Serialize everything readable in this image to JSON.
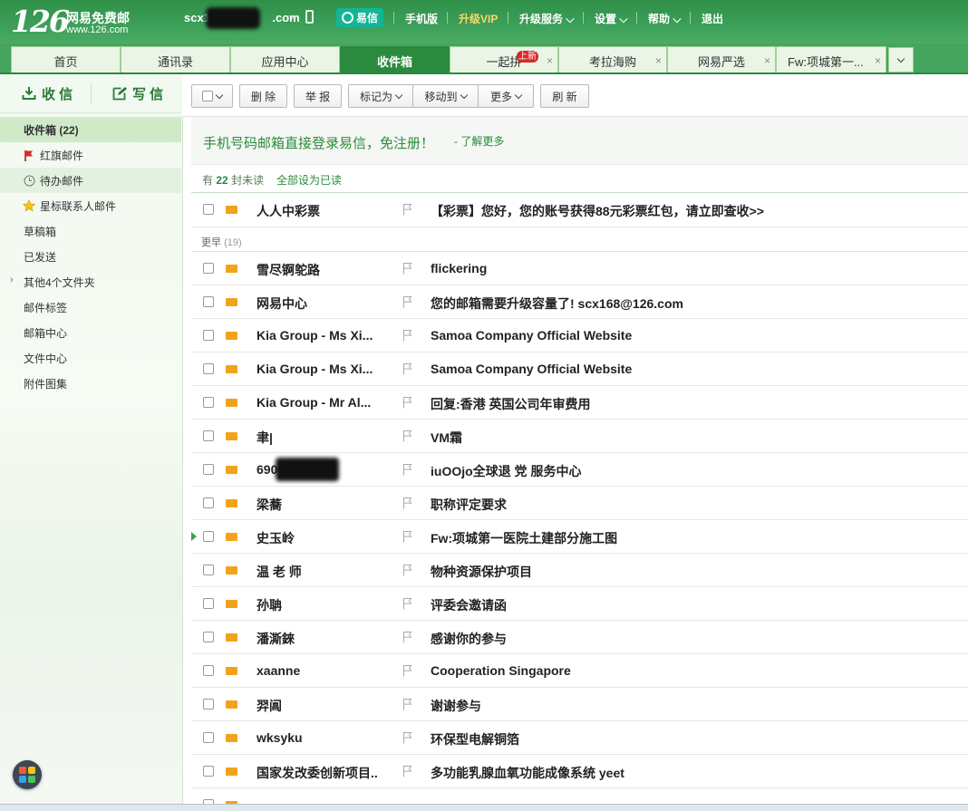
{
  "header": {
    "logo_number": "126",
    "logo_title": "网易免费邮",
    "logo_site": "www.126.com",
    "account_visible": "scx168",
    "account_tail": ".com",
    "yixin": "易信",
    "links": [
      "手机版",
      "升级VIP",
      "升级服务",
      "设置",
      "帮助",
      "退出"
    ]
  },
  "tabs": [
    {
      "label": "首页"
    },
    {
      "label": "通讯录"
    },
    {
      "label": "应用中心"
    },
    {
      "label": "收件箱"
    },
    {
      "label": "一起拼",
      "badge": "上新"
    },
    {
      "label": "考拉海购"
    },
    {
      "label": "网易严选"
    },
    {
      "label": "Fw:项城第一..."
    }
  ],
  "sidebar": {
    "receive": "收 信",
    "compose": "写 信",
    "folders": [
      {
        "label": "收件箱 (22)"
      },
      {
        "label": "红旗邮件"
      },
      {
        "label": "待办邮件"
      },
      {
        "label": "星标联系人邮件"
      },
      {
        "label": "草稿箱"
      },
      {
        "label": "已发送"
      },
      {
        "label": "其他4个文件夹"
      },
      {
        "label": "邮件标签"
      },
      {
        "label": "邮箱中心"
      },
      {
        "label": "文件中心"
      },
      {
        "label": "附件图集"
      }
    ]
  },
  "toolbar": {
    "delete": "删 除",
    "report": "举 报",
    "mark_as": "标记为",
    "move_to": "移动到",
    "more": "更多",
    "refresh": "刷 新"
  },
  "notice": {
    "text": "手机号码邮箱直接登录易信，免注册！",
    "link": "- 了解更多"
  },
  "unread": {
    "prefix": "有",
    "count": "22",
    "suffix": "封未读",
    "mark_all": "全部设为已读"
  },
  "group": {
    "label": "更早",
    "count": "(19)"
  },
  "mail_rows": [
    {
      "sender": "人人中彩票",
      "subject": "【彩票】您好，您的账号获得88元彩票红包，请立即查收>>"
    },
    {
      "sender": "雪尽锕鸵路",
      "subject": "flickering"
    },
    {
      "sender": "网易中心",
      "subject": "您的邮箱需要升级容量了! scx168@126.com"
    },
    {
      "sender": "Kia Group - Ms Xi...",
      "subject": "Samoa Company Official Website"
    },
    {
      "sender": "Kia Group - Ms Xi...",
      "subject": "Samoa Company Official Website"
    },
    {
      "sender": "Kia Group - Mr Al...",
      "subject": "回复:香港 英国公司年审费用"
    },
    {
      "sender": "聿|",
      "subject": "VM霜"
    },
    {
      "sender": "69004",
      "subject": "iuOOjo全球退 党 服务中心"
    },
    {
      "sender": "梁蕎",
      "subject": "职称评定要求"
    },
    {
      "sender": "史玉岭",
      "subject": "Fw:项城第一医院土建部分施工图"
    },
    {
      "sender": "温 老 师",
      "subject": "物种资源保护项目"
    },
    {
      "sender": "孙聃",
      "subject": "评委会邀请函"
    },
    {
      "sender": "潘澌錸",
      "subject": "感谢你的参与"
    },
    {
      "sender": "xaanne",
      "subject": "Cooperation Singapore"
    },
    {
      "sender": "羿阊",
      "subject": "谢谢参与"
    },
    {
      "sender": "wksyku",
      "subject": "环保型电解铜箔"
    },
    {
      "sender": "国家发改委创新项目..",
      "subject": "多功能乳腺血氧功能成像系统 yeet"
    }
  ],
  "colors": {
    "brand_green": "#2b8a3e",
    "envelope": "#f2a31c",
    "yixin": "#12b596",
    "vip": "#ffd66b"
  }
}
